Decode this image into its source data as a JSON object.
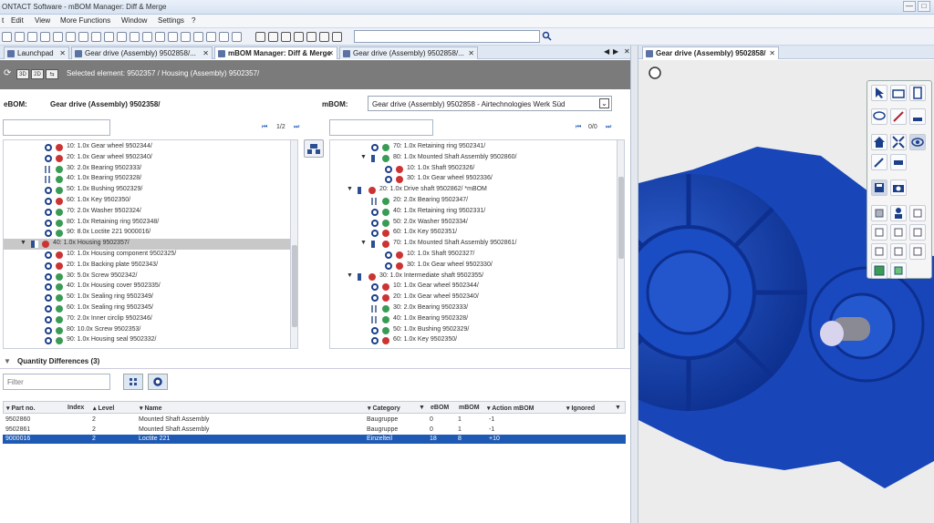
{
  "window": {
    "title": "ONTACT Software - mBOM Manager: Diff & Merge",
    "minimize": "—",
    "maximize": "□"
  },
  "menu": [
    "t",
    "Edit",
    "View",
    "More Functions",
    "Window",
    "Settings",
    "?"
  ],
  "tabs": [
    {
      "label": "Launchpad"
    },
    {
      "label": "Gear drive (Assembly) 9502858/..."
    },
    {
      "label": "mBOM Manager: Diff & Merge"
    },
    {
      "label": "Gear drive (Assembly) 9502858/..."
    }
  ],
  "header": {
    "selected_element": "Selected element: 9502357 / Housing (Assembly) 9502357/",
    "view_btns": [
      "3D",
      "2D",
      "⇆"
    ]
  },
  "ebom": {
    "label": "eBOM:",
    "value": "Gear drive (Assembly) 9502358/",
    "pager": "1/2",
    "rows": [
      {
        "text": "10: 1.0x Gear wheel 9502344/",
        "color": "#c33"
      },
      {
        "text": "20: 1.0x Gear wheel 9502340/",
        "color": "#c33"
      },
      {
        "text": "30: 2.0x Bearing 9502333/",
        "color": "#3a9b55"
      },
      {
        "text": "40: 1.0x Bearing 9502328/",
        "color": "#3a9b55"
      },
      {
        "text": "50: 1.0x Bushing 9502329/",
        "color": "#3a9b55"
      },
      {
        "text": "60: 1.0x Key 9502350/",
        "color": "#c33"
      },
      {
        "text": "70: 2.0x Washer 9502324/",
        "color": "#3a9b55"
      },
      {
        "text": "80: 1.0x Retaining ring 9502348/",
        "color": "#3a9b55"
      },
      {
        "text": "90: 8.0x Loctite 221 9000016/",
        "color": "#3a9b55"
      },
      {
        "text": "40: 1.0x Housing 9502357/",
        "color": "#c33"
      },
      {
        "text": "10: 1.0x Housing component 9502325/",
        "color": "#c33"
      },
      {
        "text": "20: 1.0x Backing plate 9502343/",
        "color": "#c33"
      },
      {
        "text": "30: 5.0x Screw 9502342/",
        "color": "#3a9b55"
      },
      {
        "text": "40: 1.0x Housing cover 9502335/",
        "color": "#3a9b55"
      },
      {
        "text": "50: 1.0x Sealing ring 9502349/",
        "color": "#3a9b55"
      },
      {
        "text": "60: 1.0x Sealing ring 9502345/",
        "color": "#3a9b55"
      },
      {
        "text": "70: 2.0x Inner circlip 9502346/",
        "color": "#3a9b55"
      },
      {
        "text": "80: 10.0x Screw 9502353/",
        "color": "#3a9b55"
      },
      {
        "text": "90: 1.0x Housing seal 9502332/",
        "color": "#3a9b55"
      }
    ]
  },
  "mbom": {
    "label": "mBOM:",
    "value": "Gear drive (Assembly) 9502858 - Airtechnologies Werk Süd",
    "pager": "0/0",
    "rows": [
      {
        "text": "70: 1.0x Retaining ring 9502341/",
        "color": "#3a9b55"
      },
      {
        "text": "80: 1.0x Mounted Shaft Assembly 9502860/",
        "color": "#3a9b55"
      },
      {
        "text": "10: 1.0x Shaft 9502326/",
        "color": "#c33"
      },
      {
        "text": "30: 1.0x Gear wheel 9502336/",
        "color": "#c33"
      },
      {
        "text": "20: 1.0x Drive shaft 9502862/ *mBOM",
        "color": "#c33"
      },
      {
        "text": "20: 2.0x Bearing 9502347/",
        "color": "#3a9b55"
      },
      {
        "text": "40: 1.0x Retaining ring 9502331/",
        "color": "#3a9b55"
      },
      {
        "text": "50: 2.0x Washer 9502334/",
        "color": "#3a9b55"
      },
      {
        "text": "60: 1.0x Key 9502351/",
        "color": "#c33"
      },
      {
        "text": "70: 1.0x Mounted Shaft Assembly 9502861/",
        "color": "#c33"
      },
      {
        "text": "10: 1.0x Shaft 9502327/",
        "color": "#c33"
      },
      {
        "text": "30: 1.0x Gear wheel 9502330/",
        "color": "#c33"
      },
      {
        "text": "30: 1.0x Intermediate shaft 9502355/",
        "color": "#c33"
      },
      {
        "text": "10: 1.0x Gear wheel 9502344/",
        "color": "#c33"
      },
      {
        "text": "20: 1.0x Gear wheel 9502340/",
        "color": "#c33"
      },
      {
        "text": "30: 2.0x Bearing 9502333/",
        "color": "#3a9b55"
      },
      {
        "text": "40: 1.0x Bearing 9502328/",
        "color": "#3a9b55"
      },
      {
        "text": "50: 1.0x Bushing 9502329/",
        "color": "#3a9b55"
      },
      {
        "text": "60: 1.0x Key 9502350/",
        "color": "#c33"
      }
    ]
  },
  "quantity": {
    "title": "Quantity Differences (3)",
    "filter_placeholder": "Filter",
    "columns": [
      "Part no.",
      "Index",
      "Level",
      "Name",
      "Category",
      "eBOM",
      "mBOM",
      "Action mBOM",
      "Ignored"
    ],
    "rows": [
      [
        "9502860",
        "",
        "2",
        "Mounted Shaft Assembly",
        "Baugruppe",
        "0",
        "1",
        "-1",
        ""
      ],
      [
        "9502861",
        "",
        "2",
        "Mounted Shaft Assembly",
        "Baugruppe",
        "0",
        "1",
        "-1",
        ""
      ],
      [
        "9000016",
        "",
        "2",
        "Loctite 221",
        "Einzelteil",
        "18",
        "8",
        "+10",
        ""
      ]
    ]
  },
  "viewer": {
    "tab_label": "Gear drive (Assembly) 9502858/"
  }
}
